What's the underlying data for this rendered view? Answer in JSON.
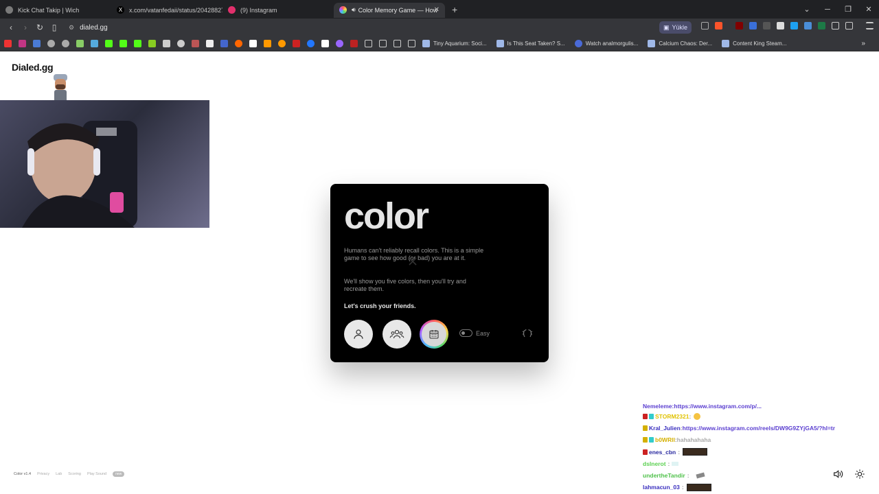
{
  "browser": {
    "tabs": [
      {
        "title": "Kick Chat Takip | Wich",
        "icon_color": "#7a7a7a",
        "active": false
      },
      {
        "title": "x.com/vatanfedaii/status/20428827",
        "icon_color": "#000000",
        "active": false
      },
      {
        "title": "(9) Instagram",
        "icon_color": "#e1306c",
        "active": false
      },
      {
        "title": "Color Memory Game — How",
        "icon_color": "#8a6cff",
        "active": true
      }
    ],
    "new_tab": "+",
    "url": "dialed.gg",
    "yukle_label": "Yükle",
    "bookmarks": [
      {
        "label": "Tiny Aquarium: Soci..."
      },
      {
        "label": "Is This Seat Taken? S..."
      },
      {
        "label": "Watch analmorgulis..."
      },
      {
        "label": "Calcium Chaos: Der..."
      },
      {
        "label": "Content King Steam..."
      }
    ],
    "bookmark_icon_colors": [
      "#e33",
      "#c13584",
      "#4a7bd6",
      "#aaa",
      "#aaa",
      "#8c6",
      "#5ad",
      "#53fc18",
      "#53fc18",
      "#53fc18",
      "#8c2",
      "#ccc",
      "#ccc",
      "#b55",
      "#eee",
      "#46c",
      "#f60",
      "#fff",
      "#f90",
      "#f90",
      "#c22",
      "#27f",
      "#fff",
      "#96f",
      "#b22"
    ]
  },
  "page": {
    "site_name": "Dialed.gg",
    "card": {
      "title": "color",
      "intro": "Humans can't reliably recall colors. This is a simple game to see how good (or bad) you are at it.",
      "details": "We'll show you five colors, then you'll try and recreate them.",
      "cta": "Let's crush your friends.",
      "difficulty_label": "Easy",
      "modes": [
        "solo-icon",
        "multiplayer-icon",
        "daily-calendar-icon"
      ]
    },
    "footer": {
      "version": "Color v1.4",
      "links": [
        "Privacy",
        "Lab",
        "Scoring",
        "Play Sound"
      ],
      "badge": "new"
    }
  },
  "chat": [
    {
      "user": "Nemeleme",
      "message": "https://www.instagram.com/p/...",
      "user_color": "#5b3fd0",
      "msg_color": "#5b3fd0"
    },
    {
      "user": "STORM2321",
      "message": ":",
      "user_color": "#e0c200",
      "msg_color": "#999"
    },
    {
      "user": "Kral_Julien",
      "message": "https://www.instagram.com/reels/DW9G9ZYjGA5/?hl=tr",
      "user_color": "#3a2fbf",
      "msg_color": "#5b3fd0"
    },
    {
      "user": "b0WRll",
      "message": "hahahahaha",
      "user_color": "#d4b000",
      "msg_color": "#aaa"
    },
    {
      "user": "enes_cbn",
      "message": ":",
      "user_color": "#2a2aa0",
      "msg_color": "#999"
    },
    {
      "user": "dslnerot",
      "message": ":",
      "user_color": "#5ad04f",
      "msg_color": "#999"
    },
    {
      "user": "undertheTandir",
      "message": ":",
      "user_color": "#4fc14a",
      "msg_color": "#999"
    },
    {
      "user": "lahmacun_03",
      "message": ":",
      "user_color": "#3a2fbf",
      "msg_color": "#999"
    }
  ]
}
